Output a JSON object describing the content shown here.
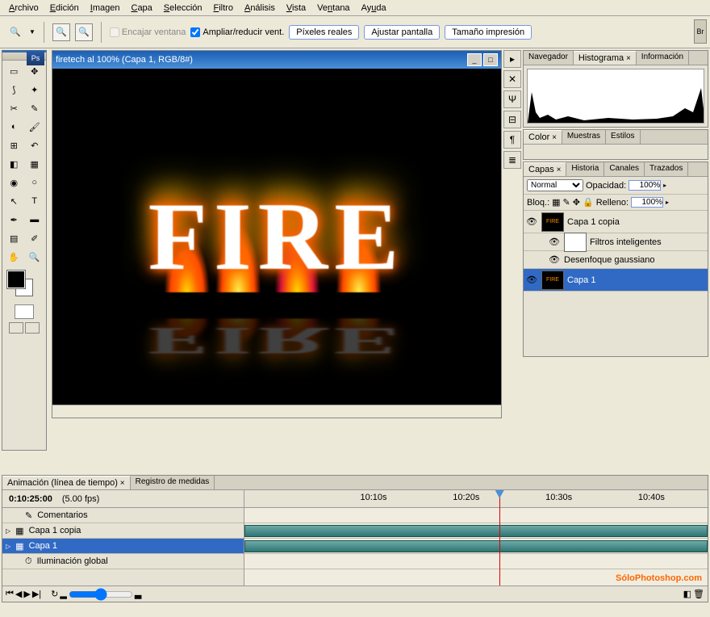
{
  "menu": {
    "items": [
      "Archivo",
      "Edición",
      "Imagen",
      "Capa",
      "Selección",
      "Filtro",
      "Análisis",
      "Vista",
      "Ventana",
      "Ayuda"
    ]
  },
  "options": {
    "fit_window": "Encajar ventana",
    "zoom_resize": "Ampliar/reducir vent.",
    "btn_actual": "Píxeles reales",
    "btn_fit": "Ajustar pantalla",
    "btn_print": "Tamaño impresión"
  },
  "document": {
    "title": "firetech al 100% (Capa 1, RGB/8#)",
    "canvas_text": "FIRE"
  },
  "panels": {
    "nav_tabs": [
      "Navegador",
      "Histograma",
      "Información"
    ],
    "color_tabs": [
      "Color",
      "Muestras",
      "Estilos"
    ],
    "layer_tabs": [
      "Capas",
      "Historia",
      "Canales",
      "Trazados"
    ]
  },
  "layers_panel": {
    "blend_mode": "Normal",
    "opacity_label": "Opacidad:",
    "opacity_value": "100%",
    "lock_label": "Bloq.:",
    "fill_label": "Relleno:",
    "fill_value": "100%",
    "layers": [
      {
        "name": "Capa 1 copia",
        "selected": false
      },
      {
        "name": "Filtros inteligentes",
        "sub": true
      },
      {
        "name": "Desenfoque gaussiano",
        "sub": true,
        "effect": true
      },
      {
        "name": "Capa 1",
        "selected": true
      }
    ]
  },
  "timeline": {
    "tabs": [
      "Animación (línea de tiempo)",
      "Registro de medidas"
    ],
    "timecode": "0:10:25:00",
    "fps": "(5.00 fps)",
    "comments": "Comentarios",
    "tracks": [
      "Capa 1 copia",
      "Capa 1",
      "Iluminación global"
    ],
    "ruler": [
      "10:10s",
      "10:20s",
      "10:30s",
      "10:40s"
    ]
  },
  "watermark": "SóloPhotoshop.com",
  "br": "Br"
}
